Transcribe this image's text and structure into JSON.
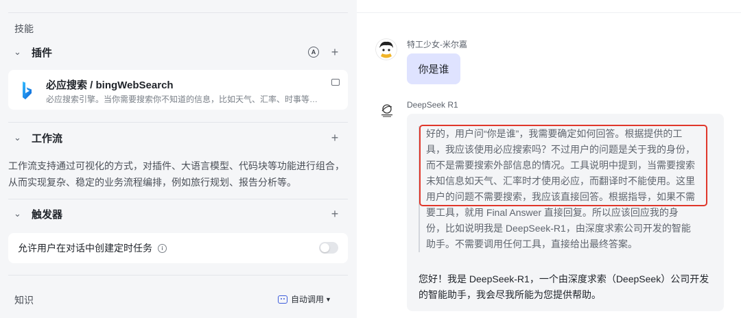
{
  "skills": {
    "title": "技能",
    "plugins": {
      "label": "插件",
      "items": [
        {
          "name": "必应搜索 / bingWebSearch",
          "description": "必应搜索引擎。当你需要搜索你不知道的信息，比如天气、汇率、时事等…"
        }
      ]
    },
    "workflow": {
      "label": "工作流",
      "description": "工作流支持通过可视化的方式，对插件、大语言模型、代码块等功能进行组合，从而实现复杂、稳定的业务流程编排，例如旅行规划、报告分析等。"
    },
    "trigger": {
      "label": "触发器",
      "option_label": "允许用户在对话中创建定时任务",
      "enabled": false
    }
  },
  "knowledge": {
    "title": "知识",
    "mode_label": "自动调用"
  },
  "chat": {
    "user": {
      "name": "特工少女-米尔嘉",
      "message": "你是谁"
    },
    "bot": {
      "name": "DeepSeek R1",
      "reasoning": "好的，用户问“你是谁”，我需要确定如何回答。根据提供的工具，我应该使用必应搜索吗？不过用户的问题是关于我的身份，而不是需要搜索外部信息的情况。工具说明中提到，当需要搜索未知信息如天气、汇率时才使用必应，而翻译时不能使用。这里用户的问题不需要搜索，我应该直接回答。根据指导，如果不需要工具，就用 Final Answer 直接回复。所以应该回应我的身份，比如说明我是 DeepSeek-R1，由深度求索公司开发的智能助手。不需要调用任何工具，直接给出最终答案。",
      "answer": "您好！我是 DeepSeek-R1，一个由深度求索（DeepSeek）公司开发的智能助手，我会尽我所能为您提供帮助。"
    }
  },
  "colors": {
    "highlight_border": "#e0362a",
    "user_bubble": "#dfe3ff",
    "accent": "#3b5bdb"
  }
}
